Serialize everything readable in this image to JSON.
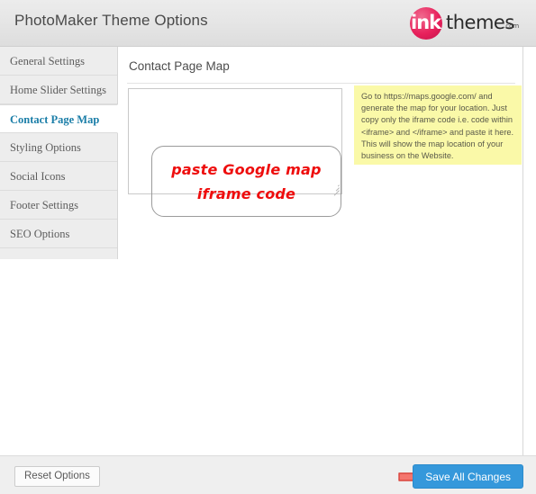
{
  "header": {
    "title": "PhotoMaker Theme Options",
    "logo": {
      "mark_text": "ink",
      "word_text": "themes",
      "tld_text": ".com",
      "circle_color": "#e8215c"
    }
  },
  "sidebar": {
    "items": [
      {
        "label": "General Settings",
        "active": false
      },
      {
        "label": "Home Slider Settings",
        "active": false
      },
      {
        "label": "Contact Page Map",
        "active": true
      },
      {
        "label": "Styling Options",
        "active": false
      },
      {
        "label": "Social Icons",
        "active": false
      },
      {
        "label": "Footer Settings",
        "active": false
      },
      {
        "label": "SEO Options",
        "active": false
      }
    ],
    "active_color": "#1b7ea8"
  },
  "main": {
    "title": "Contact Page Map",
    "iframe_field": {
      "value": "",
      "placeholder": "",
      "annotation_line1": "paste Google map",
      "annotation_line2": "iframe code",
      "annotation_color": "#ee0d0d"
    },
    "help": {
      "text": "Go to https://maps.google.com/ and generate the map for your location. Just copy only the iframe code i.e. code within <iframe> and </iframe> and paste it here. This will show the map location of your business on the Website.",
      "background": "#faf9a8"
    }
  },
  "footer": {
    "reset_label": "Reset Options",
    "save_label": "Save All Changes",
    "save_color": "#3598db",
    "arrow_color": "#f4766e"
  }
}
